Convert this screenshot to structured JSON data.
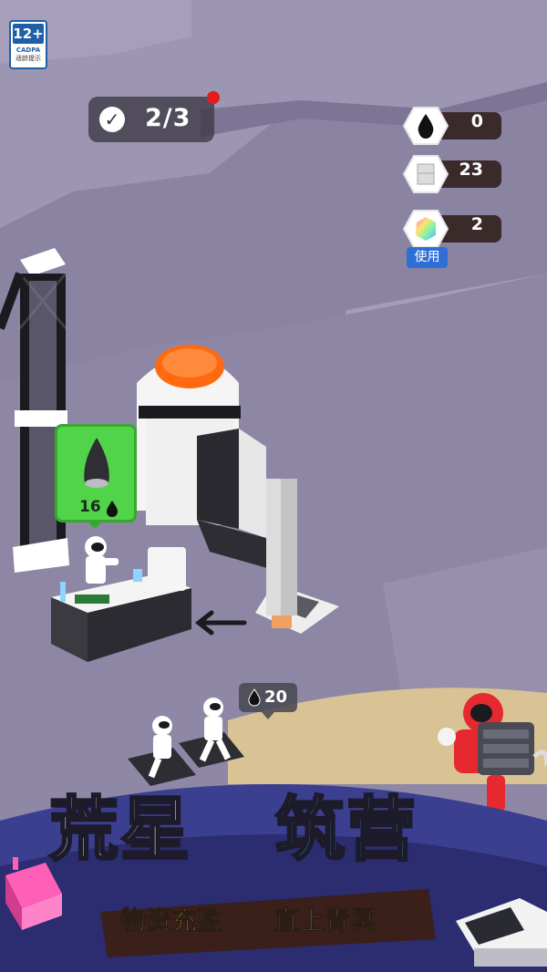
{
  "rating": {
    "age": "12+",
    "org": "CADPA",
    "tip": "适龄提示"
  },
  "progress": {
    "check_icon": "checkmark-icon",
    "count": "2/3",
    "has_alert": true
  },
  "resources": [
    {
      "icon": "oil-drop-icon",
      "value": "0"
    },
    {
      "icon": "block-icon",
      "value": "23"
    },
    {
      "icon": "rainbow-gem-icon",
      "value": "2"
    }
  ],
  "use_button": "使用",
  "rocket_nose_price": {
    "icon": "oil-drop-icon",
    "amount": "16"
  },
  "astronaut_cost": {
    "icon": "oil-drop-icon",
    "amount": "20"
  },
  "title": {
    "part1": "荒星",
    "part2": "筑营"
  },
  "subtitle": {
    "part1": "物资充盈",
    "part2": "直上青冥"
  },
  "colors": {
    "ground": "#8f87a6",
    "accent_orange": "#ff6a10",
    "price_green": "#52d44a",
    "title_blue": "#29c9f0",
    "subtitle_yellow": "#ffe84a"
  }
}
